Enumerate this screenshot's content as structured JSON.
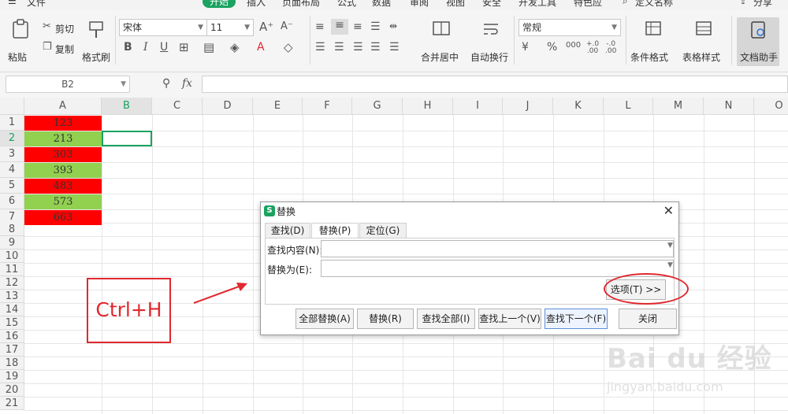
{
  "menu": {
    "items": [
      "文件",
      "开始",
      "插入",
      "页面布局",
      "公式",
      "数据",
      "审阅",
      "视图",
      "安全",
      "开发工具",
      "特色应",
      "定义名称",
      "分享"
    ]
  },
  "ribbon": {
    "paste": "粘贴",
    "cut": "剪切",
    "copy": "复制",
    "format_painter": "格式刷",
    "font_name": "宋体",
    "font_size": "11",
    "merge_center": "合并居中",
    "wrap_text": "自动换行",
    "number_format": "常规",
    "conditional_format": "条件格式",
    "table_style": "表格样式",
    "doc_assistant": "文档助手"
  },
  "formula_bar": {
    "name_box": "B2",
    "fx": "fx"
  },
  "sheet": {
    "columns": [
      "A",
      "B",
      "C",
      "D",
      "E",
      "F",
      "G",
      "H",
      "I",
      "J",
      "K",
      "L",
      "M",
      "N",
      "O"
    ],
    "rows": [
      "1",
      "2",
      "3",
      "4",
      "5",
      "6",
      "7",
      "8",
      "9",
      "10",
      "11",
      "12",
      "13",
      "14",
      "15",
      "16",
      "17",
      "18",
      "19",
      "20",
      "21"
    ],
    "cells_a": [
      {
        "value": "123",
        "fill": "#ff0000"
      },
      {
        "value": "213",
        "fill": "#92d050"
      },
      {
        "value": "303",
        "fill": "#ff0000"
      },
      {
        "value": "393",
        "fill": "#92d050"
      },
      {
        "value": "483",
        "fill": "#ff0000"
      },
      {
        "value": "573",
        "fill": "#92d050"
      },
      {
        "value": "663",
        "fill": "#ff0000"
      }
    ]
  },
  "annotation": {
    "shortcut": "Ctrl+H",
    "color": "#e0282e"
  },
  "dialog": {
    "title": "替换",
    "logo": "S",
    "tabs": [
      "查找(D)",
      "替换(P)",
      "定位(G)"
    ],
    "active_tab": "替换(P)",
    "find_label": "查找内容(N):",
    "find_value": "",
    "replace_label": "替换为(E):",
    "replace_value": "",
    "options_button": "选项(T) >>",
    "buttons": [
      "全部替换(A)",
      "替换(R)",
      "查找全部(I)",
      "查找上一个(V)",
      "查找下一个(F)",
      "关闭"
    ]
  },
  "watermark": {
    "brand": "Bai du 经验",
    "url": "jingyan.baidu.com"
  }
}
